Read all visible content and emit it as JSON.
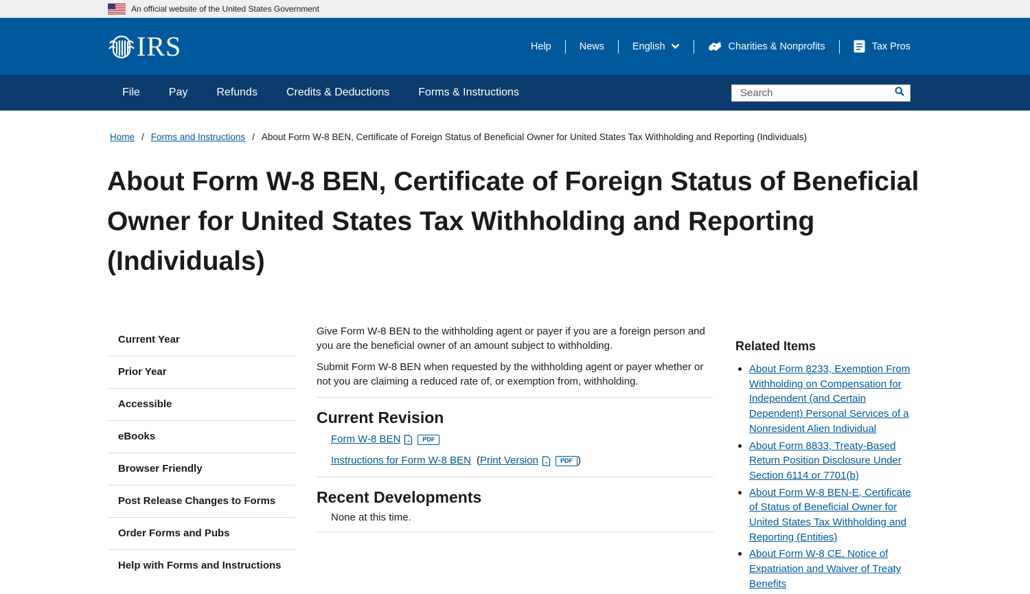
{
  "gov_banner": {
    "text": "An official website of the United States Government"
  },
  "header": {
    "logo_text": "IRS",
    "utility_nav": {
      "help": "Help",
      "news": "News",
      "language": "English",
      "charities": "Charities & Nonprofits",
      "tax_pros": "Tax Pros"
    }
  },
  "main_nav": {
    "items": [
      "File",
      "Pay",
      "Refunds",
      "Credits & Deductions",
      "Forms & Instructions"
    ],
    "search_placeholder": "Search"
  },
  "breadcrumb": {
    "home": "Home",
    "forms": "Forms and Instructions",
    "separator": "/",
    "current": "About Form W-8 BEN, Certificate of Foreign Status of Beneficial Owner for United States Tax Withholding and Reporting (Individuals)"
  },
  "page_title": "About Form W-8 BEN, Certificate of Foreign Status of Beneficial Owner for United States Tax Withholding and Reporting (Individuals)",
  "sidebar": {
    "items": [
      "Current Year",
      "Prior Year",
      "Accessible",
      "eBooks",
      "Browser Friendly",
      "Post Release Changes to Forms",
      "Order Forms and Pubs",
      "Help with Forms and Instructions"
    ]
  },
  "content": {
    "intro_1": "Give Form W-8 BEN to the withholding agent or payer if you are a foreign person and you are the beneficial owner of an amount subject to withholding.",
    "intro_2": "Submit Form W-8 BEN when requested by the withholding agent or payer whether or not you are claiming a reduced rate of, or exemption from, withholding.",
    "current_revision_heading": "Current Revision",
    "form_link": "Form W-8 BEN",
    "pdf_label": "PDF",
    "instructions_link": "Instructions for Form W-8 BEN",
    "print_open": "(",
    "print_version": "Print Version",
    "print_close": ")",
    "recent_heading": "Recent Developments",
    "recent_text": "None at this time."
  },
  "related": {
    "heading": "Related Items",
    "items": [
      "About Form 8233, Exemption From Withholding on Compensation for Independent (and Certain Dependent) Personal Services of a Nonresident Alien Individual",
      "About Form 8833, Treaty-Based Return Position Disclosure Under Section 6114 or 7701(b)",
      "About Form W-8 BEN-E, Certificate of Status of Beneficial Owner for United States Tax Withholding and Reporting (Entities)",
      "About Form W-8 CE, Notice of Expatriation and Waiver of Treaty Benefits"
    ]
  },
  "colors": {
    "header_blue": "#00599c",
    "nav_navy": "#0b3c6d",
    "link_blue": "#00599c"
  }
}
